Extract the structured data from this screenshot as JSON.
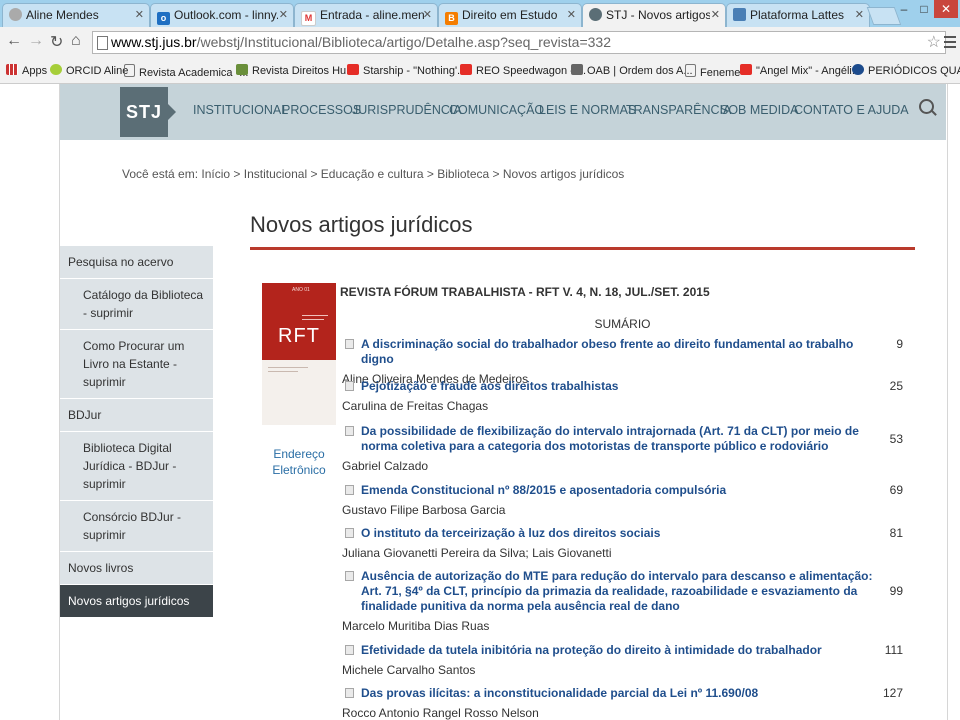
{
  "browser": {
    "tabs": [
      {
        "title": "Aline Mendes",
        "icon": "chrome-icon"
      },
      {
        "title": "Outlook.com - linny.mend",
        "icon": "outlook-icon"
      },
      {
        "title": "Entrada - aline.mendes.de",
        "icon": "gmail-icon"
      },
      {
        "title": "Direito em Estudo",
        "icon": "blogger-icon"
      },
      {
        "title": "STJ - Novos artigos jurídic",
        "icon": "stj-icon"
      },
      {
        "title": "Plataforma Lattes",
        "icon": "page-icon"
      }
    ],
    "active_tab": 4,
    "url_host": "www.stj.jus.br",
    "url_path": "/webstj/Institucional/Biblioteca/artigo/Detalhe.asp?seq_revista=332",
    "bookmarks": [
      {
        "label": "Apps",
        "icon": "apps-icon"
      },
      {
        "label": "ORCID Aline",
        "icon": "orcid-icon"
      },
      {
        "label": "Revista Academica -...",
        "icon": "page-icon"
      },
      {
        "label": "Revista Direitos Hu...",
        "icon": "books-icon"
      },
      {
        "label": "Starship - \"Nothing'...",
        "icon": "youtube-icon"
      },
      {
        "label": "REO Speedwagon - ...",
        "icon": "youtube-icon"
      },
      {
        "label": "OAB | Ordem dos A...",
        "icon": "oab-icon"
      },
      {
        "label": "Feneme",
        "icon": "page-icon"
      },
      {
        "label": "\"Angel Mix\" - Angéli...",
        "icon": "youtube-icon"
      },
      {
        "label": "PERIÓDICOS QUALI...",
        "icon": "capes-icon"
      }
    ]
  },
  "site": {
    "logo": "STJ",
    "nav": [
      "INSTITUCIONAL",
      "PROCESSOS",
      "JURISPRUDÊNCIA",
      "COMUNICAÇÃO",
      "LEIS E NORMAS",
      "TRANSPARÊNCIA",
      "SOB MEDIDA",
      "CONTATO E AJUDA"
    ],
    "breadcrumb": "Você está em: Início > Institucional > Educação e cultura > Biblioteca > Novos artigos jurídicos",
    "page_title": "Novos artigos jurídicos"
  },
  "sidebar": [
    {
      "label": "Pesquisa no acervo",
      "kind": "sec"
    },
    {
      "label": "Catálogo da Biblioteca - suprimir",
      "kind": "sub"
    },
    {
      "label": "Como Procurar um Livro na Estante - suprimir",
      "kind": "sub"
    },
    {
      "label": "BDJur",
      "kind": "sec"
    },
    {
      "label": "Biblioteca Digital Jurídica - BDJur - suprimir",
      "kind": "sub"
    },
    {
      "label": "Consórcio BDJur - suprimir",
      "kind": "sub"
    },
    {
      "label": "Novos livros",
      "kind": "sec"
    },
    {
      "label": "Novos artigos jurídicos",
      "kind": "sec",
      "active": true
    }
  ],
  "journal": {
    "cover_text": "RFT",
    "cover_top": "ANO 01",
    "link": "Endereço Eletrônico",
    "title": "REVISTA FÓRUM TRABALHISTA - RFT V. 4, N. 18, JUL./SET. 2015",
    "summary_heading": "SUMÁRIO"
  },
  "articles": [
    {
      "title": "A discriminação social do trabalhador obeso frente ao direito fundamental ao trabalho digno",
      "author": "Aline Oliveira Mendes de Medeiros",
      "page": "9"
    },
    {
      "title": "Pejotização e fraude aos direitos trabalhistas",
      "author": "Carulina de Freitas Chagas",
      "page": "25"
    },
    {
      "title": "Da possibilidade de flexibilização do intervalo intrajornada (Art. 71 da CLT) por meio de norma coletiva para a categoria dos motoristas de transporte público e rodoviário",
      "author": "Gabriel Calzado",
      "page": "53"
    },
    {
      "title": "Emenda Constitucional nº 88/2015 e aposentadoria compulsória",
      "author": "Gustavo Filipe Barbosa Garcia",
      "page": "69"
    },
    {
      "title": "O instituto da terceirização à luz dos direitos sociais",
      "author": "Juliana Giovanetti Pereira da Silva; Lais Giovanetti",
      "page": "81"
    },
    {
      "title": "Ausência de autorização do MTE para redução do intervalo para descanso e alimentação: Art. 71, §4º da CLT, princípio da primazia da realidade, razoabilidade e esvaziamento da finalidade punitiva da norma pela ausência real de dano",
      "author": "Marcelo Muritiba Dias Ruas",
      "page": "99"
    },
    {
      "title": "Efetividade da tutela inibitória na proteção do direito à intimidade do trabalhador",
      "author": "Michele Carvalho Santos",
      "page": "111"
    },
    {
      "title": "Das provas ilícitas: a inconstitucionalidade parcial da Lei nº 11.690/08",
      "author": "Rocco Antonio Rangel Rosso Nelson",
      "page": "127"
    }
  ]
}
